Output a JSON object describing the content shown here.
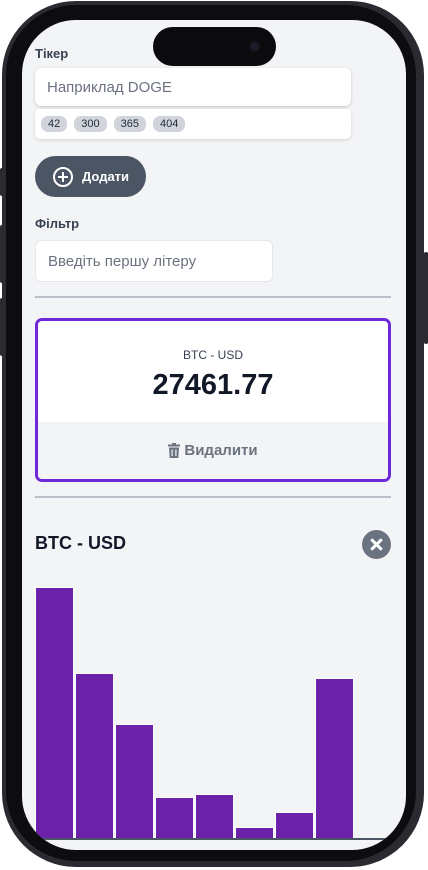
{
  "ticker": {
    "label": "Тікер",
    "placeholder": "Наприклад DOGE",
    "suggestions": [
      "42",
      "300",
      "365",
      "404"
    ]
  },
  "add_button": {
    "label": "Додати"
  },
  "filter": {
    "label": "Фільтр",
    "placeholder": "Введіть першу літеру"
  },
  "card": {
    "pair": "BTC - USD",
    "price": "27461.77",
    "delete_label": "Видалити"
  },
  "graph": {
    "title": "BTC - USD",
    "bar_fill": "#6b21a8"
  },
  "chart_data": {
    "type": "bar",
    "values": [
      1.0,
      0.66,
      0.46,
      0.17,
      0.18,
      0.05,
      0.11,
      0.64
    ]
  },
  "colors": {
    "accent": "#6d28d9",
    "button": "#4b5563",
    "background": "#f3f4f6"
  }
}
